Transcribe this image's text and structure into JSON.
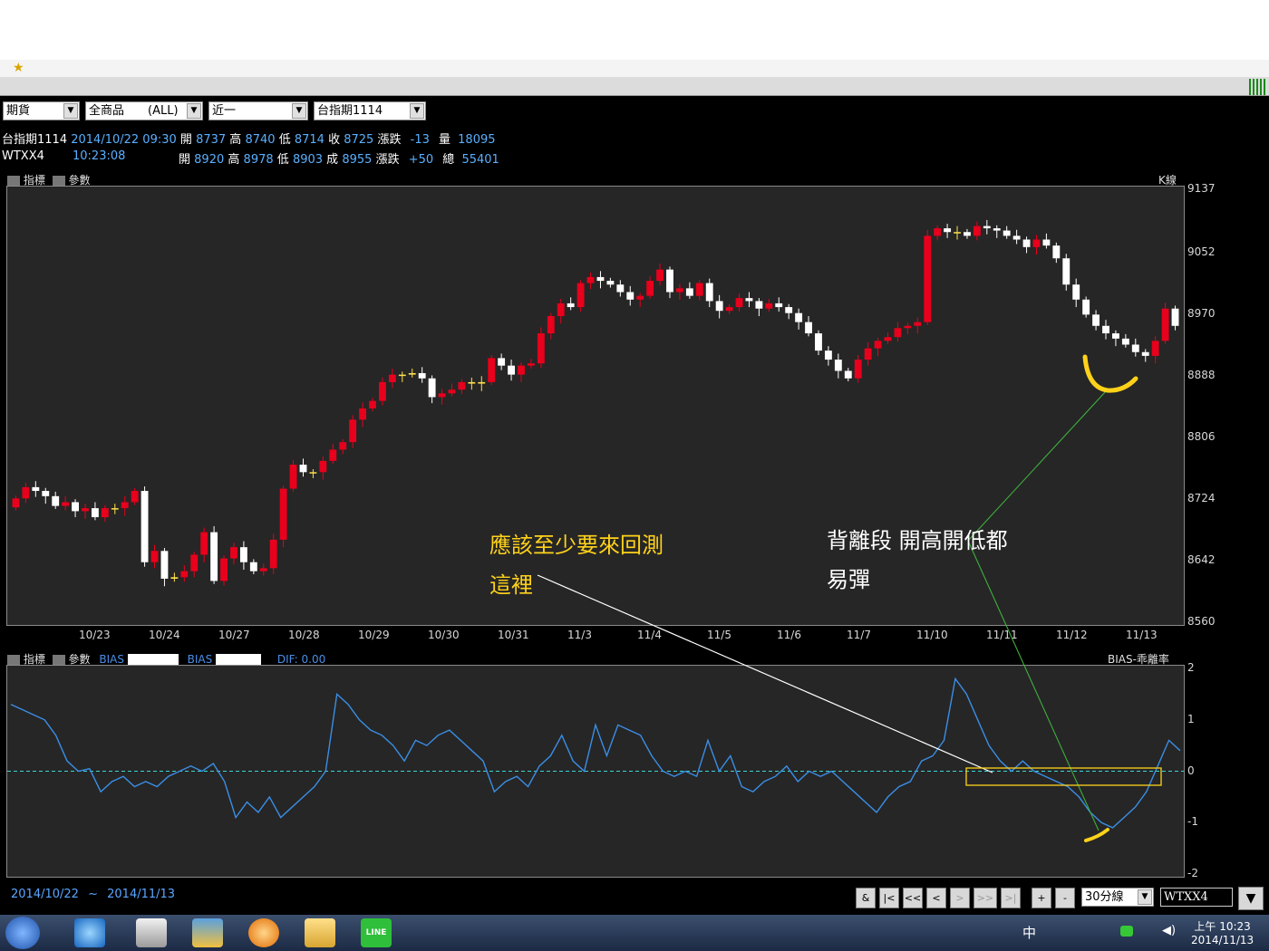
{
  "toolbar": {
    "selects": [
      {
        "label": "期貨"
      },
      {
        "label": "全商品　　(ALL)"
      },
      {
        "label": "近一"
      },
      {
        "label": "台指期1114"
      }
    ]
  },
  "quote": {
    "row1": {
      "symbol": "台指期1114",
      "datetime": "2014/10/22 09:30",
      "open_label": "開",
      "open": "8737",
      "high_label": "高",
      "high": "8740",
      "low_label": "低",
      "low": "8714",
      "close_label": "收",
      "close": "8725",
      "chg_label": "漲跌",
      "chg": "-13",
      "vol_label": "量",
      "vol": "18095"
    },
    "row2": {
      "symbol": "WTXX4",
      "time": "10:23:08",
      "open_label": "開",
      "open": "8920",
      "high_label": "高",
      "high": "8978",
      "low_label": "低",
      "low": "8903",
      "close_label": "成",
      "close": "8955",
      "chg_label": "漲跌",
      "chg": "+50",
      "vol_label": "總",
      "vol": "55401"
    }
  },
  "main_panel": {
    "btn_indicator": "指標",
    "btn_param": "參數",
    "type_label": "K線"
  },
  "sub_panel": {
    "btn_indicator": "指標",
    "btn_param": "參數",
    "bias1": "BIAS",
    "bias2": "BIAS",
    "dif_label": "DIF:",
    "dif_value": "0.00",
    "title": "BIAS-乖離率"
  },
  "annotations": {
    "left_line1": "應該至少要來回測",
    "left_line2": "這裡",
    "right_line1": "背離段 開高開低都",
    "right_line2": "易彈"
  },
  "footer": {
    "date_from": "2014/10/22",
    "tilde": "~",
    "date_to": "2014/11/13",
    "interval": "30分線",
    "symbol": "WTXX4",
    "nav": [
      "&",
      "|<",
      "<<",
      "<",
      ">",
      ">>",
      ">|",
      "+",
      "-"
    ]
  },
  "taskbar": {
    "ampm_time": "上午 10:23",
    "date": "2014/11/13",
    "ime": "中"
  },
  "colors": {
    "up": "#e8001c",
    "down": "#ffffff",
    "bias_line": "#3a8ee6",
    "zero_line": "#3ad6d6",
    "annot_yellow": "#ffd21a",
    "annot_white": "#ffffff"
  },
  "chart_data": [
    {
      "type": "candlestick",
      "title": "",
      "x_ticks": [
        "10/23",
        "10/24",
        "10/27",
        "10/28",
        "10/29",
        "10/30",
        "10/31",
        "11/3",
        "11/4",
        "11/5",
        "11/6",
        "11/7",
        "11/10",
        "11/11",
        "11/12",
        "11/13"
      ],
      "y_ticks": [
        9137,
        9052,
        8970,
        8888,
        8806,
        8724,
        8642,
        8560
      ],
      "ylim": [
        8560,
        9137
      ],
      "close_path": [
        8725,
        8740,
        8735,
        8728,
        8715,
        8720,
        8708,
        8712,
        8700,
        8712,
        8712,
        8720,
        8735,
        8640,
        8655,
        8618,
        8620,
        8628,
        8650,
        8680,
        8615,
        8645,
        8660,
        8640,
        8628,
        8632,
        8670,
        8738,
        8770,
        8760,
        8760,
        8775,
        8790,
        8800,
        8830,
        8845,
        8855,
        8880,
        8890,
        8890,
        8892,
        8885,
        8860,
        8865,
        8870,
        8880,
        8878,
        8880,
        8912,
        8902,
        8890,
        8902,
        8905,
        8945,
        8968,
        8985,
        8980,
        9012,
        9020,
        9015,
        9010,
        9000,
        8990,
        8995,
        9015,
        9030,
        9000,
        9005,
        8995,
        9012,
        8988,
        8975,
        8980,
        8992,
        8988,
        8978,
        8985,
        8980,
        8972,
        8960,
        8945,
        8922,
        8910,
        8895,
        8885,
        8910,
        8925,
        8935,
        8940,
        8952,
        8955,
        8960,
        9075,
        9085,
        9080,
        9080,
        9075,
        9088,
        9085,
        9082,
        9075,
        9070,
        9060,
        9070,
        9062,
        9045,
        9010,
        8990,
        8970,
        8955,
        8945,
        8938,
        8930,
        8920,
        8915,
        8935,
        8978,
        8955
      ]
    },
    {
      "type": "line",
      "title": "BIAS-乖離率",
      "y_ticks": [
        2,
        1,
        0,
        -1,
        -2
      ],
      "ylim": [
        -2,
        2
      ],
      "values": [
        1.3,
        1.2,
        1.1,
        1.0,
        0.7,
        0.2,
        0.0,
        0.05,
        -0.4,
        -0.2,
        -0.1,
        -0.3,
        -0.2,
        -0.3,
        -0.1,
        0.0,
        0.1,
        0.0,
        0.15,
        -0.2,
        -0.9,
        -0.6,
        -0.8,
        -0.5,
        -0.9,
        -0.7,
        -0.5,
        -0.3,
        0.0,
        1.5,
        1.3,
        1.0,
        0.8,
        0.7,
        0.5,
        0.2,
        0.6,
        0.5,
        0.7,
        0.8,
        0.6,
        0.4,
        0.2,
        -0.4,
        -0.2,
        -0.1,
        -0.3,
        0.1,
        0.3,
        0.7,
        0.2,
        0.0,
        0.9,
        0.3,
        0.9,
        0.8,
        0.7,
        0.3,
        0.0,
        -0.1,
        0.0,
        -0.1,
        0.6,
        0.0,
        0.3,
        -0.3,
        -0.4,
        -0.2,
        -0.1,
        0.1,
        -0.2,
        0.0,
        -0.1,
        0.0,
        -0.2,
        -0.4,
        -0.6,
        -0.8,
        -0.5,
        -0.3,
        -0.2,
        0.2,
        0.3,
        0.6,
        1.8,
        1.5,
        1.0,
        0.5,
        0.2,
        0.0,
        0.2,
        0.0,
        -0.1,
        -0.2,
        -0.3,
        -0.5,
        -0.8,
        -1.0,
        -1.1,
        -0.9,
        -0.7,
        -0.4,
        0.1,
        0.6,
        0.4
      ]
    }
  ]
}
